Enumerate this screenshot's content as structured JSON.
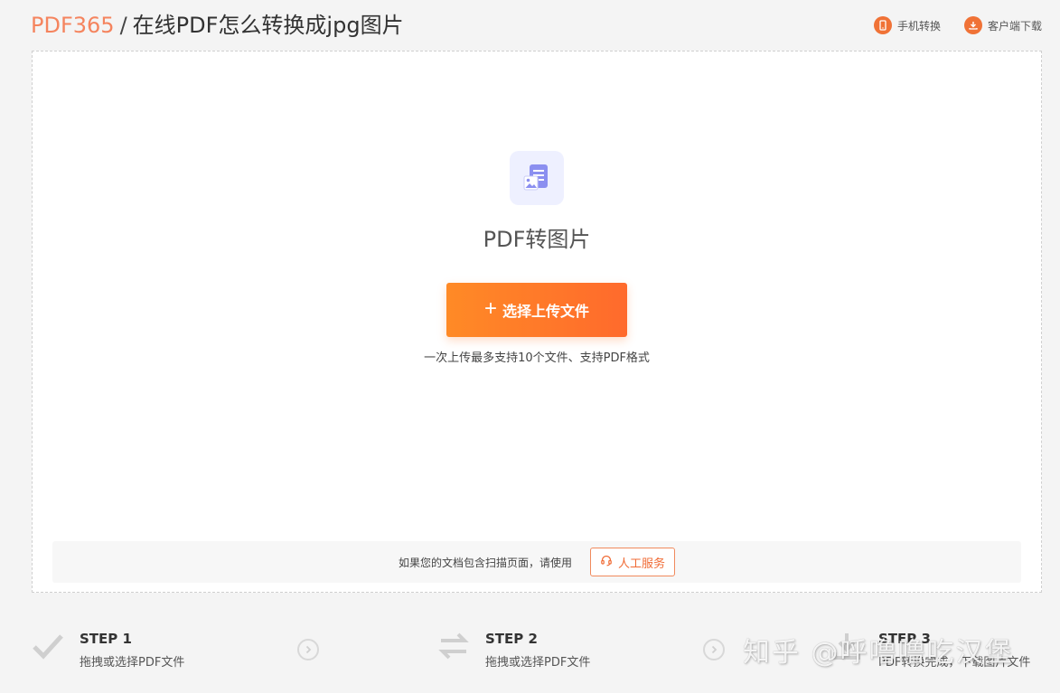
{
  "header": {
    "brand": "PDF365",
    "separator": "/",
    "title": "在线PDF怎么转换成jpg图片",
    "actions": [
      {
        "label": "手机转换",
        "icon": "phone-icon"
      },
      {
        "label": "客户端下载",
        "icon": "download-icon"
      }
    ]
  },
  "upload": {
    "tool_icon": "pdf-image-icon",
    "tool_title": "PDF转图片",
    "button_label": "选择上传文件",
    "hint": "一次上传最多支持10个文件、支持PDF格式"
  },
  "manual": {
    "text": "如果您的文档包含扫描页面，请使用",
    "button_label": "人工服务",
    "icon": "headset-icon"
  },
  "steps": [
    {
      "title": "STEP 1",
      "desc": "拖拽或选择PDF文件",
      "icon": "check-icon"
    },
    {
      "title": "STEP 2",
      "desc": "拖拽或选择PDF文件",
      "icon": "convert-icon"
    },
    {
      "title": "STEP 3",
      "desc": "PDF转换完成，下载图片文件",
      "icon": "download-icon"
    }
  ],
  "watermark": "知乎 @呼噜噜吃汉堡",
  "colors": {
    "brand": "#f5845e",
    "accent": "#ff7a28",
    "tool_icon_bg": "#eef0ff",
    "tool_icon_fg": "#8b8ff0"
  }
}
